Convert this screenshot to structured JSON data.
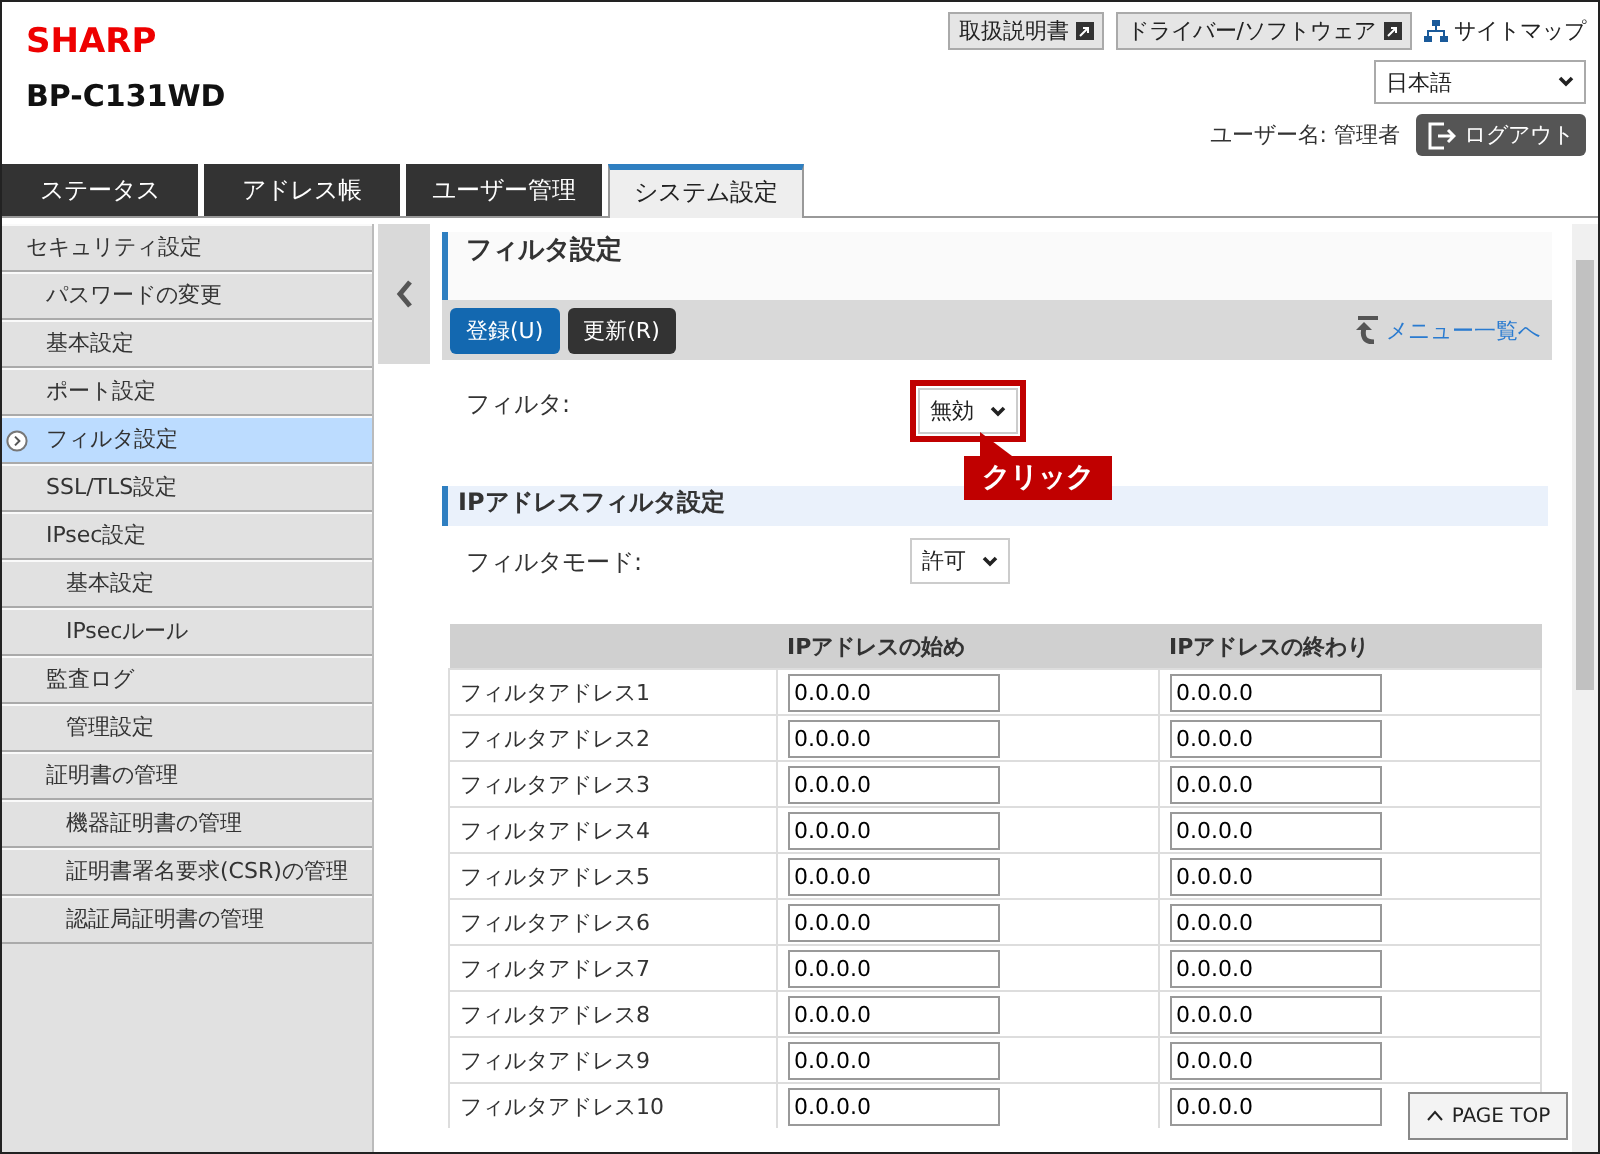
{
  "header": {
    "logo": "SHARP",
    "model": "BP-C131WD",
    "links": [
      {
        "label": "取扱説明書"
      },
      {
        "label": "ドライバー/ソフトウェア"
      }
    ],
    "sitemap": "サイトマップ",
    "language": "日本語",
    "user_label": "ユーザー名:",
    "user_name": "管理者",
    "logout": "ログアウト"
  },
  "tabs": [
    {
      "label": "ステータス",
      "selected": false
    },
    {
      "label": "アドレス帳",
      "selected": false
    },
    {
      "label": "ユーザー管理",
      "selected": false
    },
    {
      "label": "システム設定",
      "selected": true
    }
  ],
  "sidebar": {
    "items": [
      {
        "label": "セキュリティ設定",
        "selected": false,
        "children": [
          {
            "label": "パスワードの変更",
            "selected": false
          },
          {
            "label": "基本設定",
            "selected": false
          },
          {
            "label": "ポート設定",
            "selected": false
          },
          {
            "label": "フィルタ設定",
            "selected": true
          },
          {
            "label": "SSL/TLS設定",
            "selected": false
          },
          {
            "label": "IPsec設定",
            "selected": false,
            "children": [
              {
                "label": "基本設定",
                "selected": false
              },
              {
                "label": "IPsecルール",
                "selected": false
              }
            ]
          },
          {
            "label": "監査ログ",
            "selected": false,
            "children": [
              {
                "label": "管理設定",
                "selected": false
              }
            ]
          },
          {
            "label": "証明書の管理",
            "selected": false,
            "children": [
              {
                "label": "機器証明書の管理",
                "selected": false
              },
              {
                "label": "証明書署名要求(CSR)の管理",
                "selected": false
              },
              {
                "label": "認証局証明書の管理",
                "selected": false
              }
            ]
          }
        ]
      }
    ]
  },
  "main": {
    "title": "フィルタ設定",
    "buttons": [
      {
        "label": "登録(U)",
        "kind": "primary"
      },
      {
        "label": "更新(R)",
        "kind": "secondary"
      }
    ],
    "back_link": "メニュー一覧へ",
    "filter": {
      "label": "フィルタ:",
      "value": "無効",
      "highlighted": true
    },
    "callout": "クリック",
    "section_title": "IPアドレスフィルタ設定",
    "filter_mode": {
      "label": "フィルタモード:",
      "value": "許可"
    },
    "table": {
      "columns": [
        "IPアドレスの始め",
        "IPアドレスの終わり"
      ],
      "rows": [
        {
          "name": "フィルタアドレス1",
          "start": "0.0.0.0",
          "end": "0.0.0.0"
        },
        {
          "name": "フィルタアドレス2",
          "start": "0.0.0.0",
          "end": "0.0.0.0"
        },
        {
          "name": "フィルタアドレス3",
          "start": "0.0.0.0",
          "end": "0.0.0.0"
        },
        {
          "name": "フィルタアドレス4",
          "start": "0.0.0.0",
          "end": "0.0.0.0"
        },
        {
          "name": "フィルタアドレス5",
          "start": "0.0.0.0",
          "end": "0.0.0.0"
        },
        {
          "name": "フィルタアドレス6",
          "start": "0.0.0.0",
          "end": "0.0.0.0"
        },
        {
          "name": "フィルタアドレス7",
          "start": "0.0.0.0",
          "end": "0.0.0.0"
        },
        {
          "name": "フィルタアドレス8",
          "start": "0.0.0.0",
          "end": "0.0.0.0"
        },
        {
          "name": "フィルタアドレス9",
          "start": "0.0.0.0",
          "end": "0.0.0.0"
        },
        {
          "name": "フィルタアドレス10",
          "start": "0.0.0.0",
          "end": "0.0.0.0"
        }
      ]
    },
    "page_top": "PAGE TOP"
  }
}
